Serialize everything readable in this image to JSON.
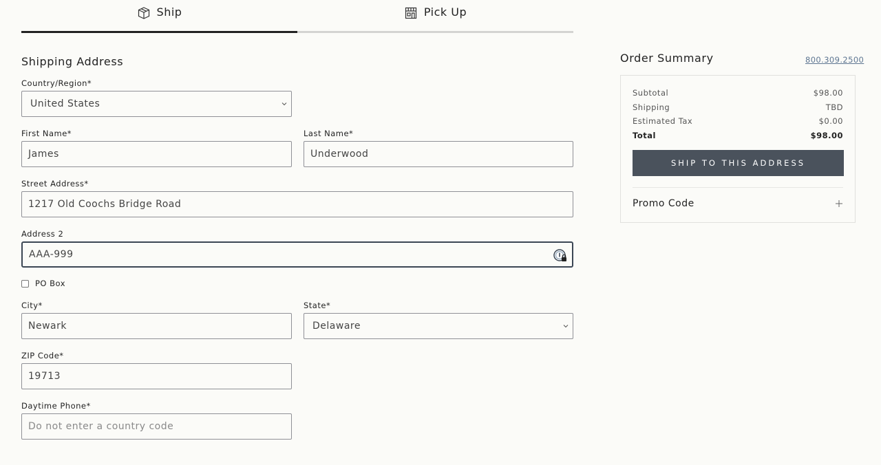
{
  "tabs": {
    "ship": {
      "label": "Ship",
      "icon": "box-icon"
    },
    "pickup": {
      "label": "Pick Up",
      "icon": "store-icon"
    }
  },
  "form": {
    "title": "Shipping Address",
    "country": {
      "label": "Country/Region*",
      "value": "United States"
    },
    "first_name": {
      "label": "First Name*",
      "value": "James"
    },
    "last_name": {
      "label": "Last Name*",
      "value": "Underwood"
    },
    "street": {
      "label": "Street Address*",
      "value": "1217 Old Coochs Bridge Road"
    },
    "address2": {
      "label": "Address 2",
      "value": "AAA-999"
    },
    "po_box": {
      "label": "PO Box",
      "checked": false
    },
    "city": {
      "label": "City*",
      "value": "Newark"
    },
    "state": {
      "label": "State*",
      "value": "Delaware"
    },
    "zip": {
      "label": "ZIP Code*",
      "value": "19713"
    },
    "phone": {
      "label": "Daytime Phone*",
      "placeholder": "Do not enter a country code"
    }
  },
  "summary": {
    "title": "Order Summary",
    "phone": "800.309.2500",
    "subtotal_label": "Subtotal",
    "subtotal_value": "$98.00",
    "shipping_label": "Shipping",
    "shipping_value": "TBD",
    "tax_label": "Estimated Tax",
    "tax_value": "$0.00",
    "total_label": "Total",
    "total_value": "$98.00",
    "ship_button": "SHIP TO THIS ADDRESS",
    "promo_label": "Promo Code"
  },
  "colors": {
    "accent": "#4a525c",
    "link": "#5d7591",
    "background": "#fbfbf8"
  }
}
